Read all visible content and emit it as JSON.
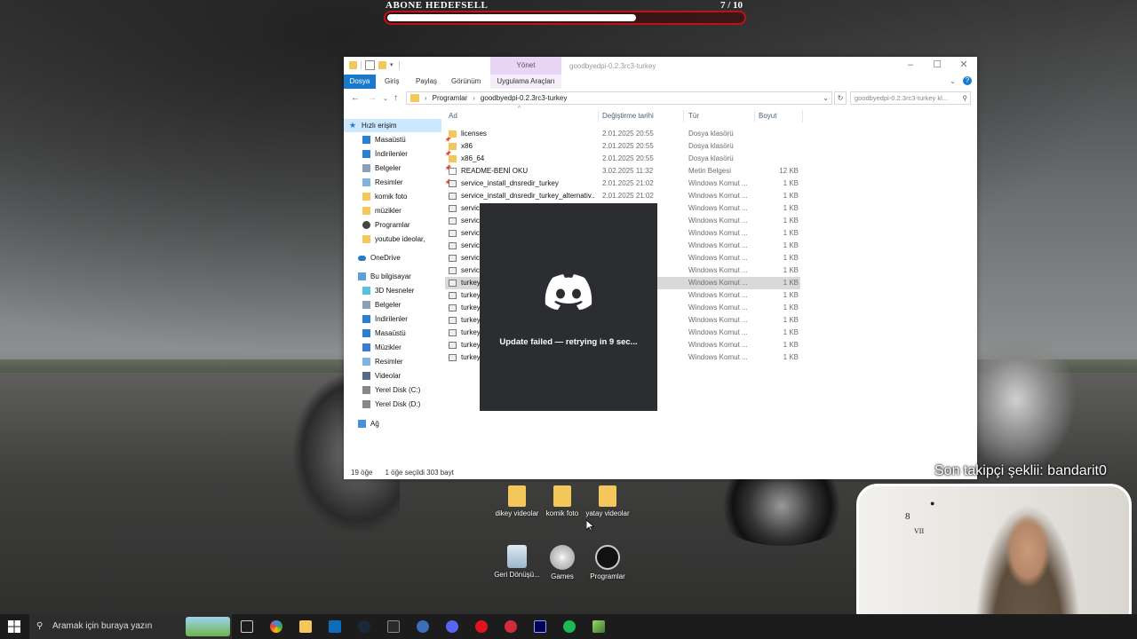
{
  "goal": {
    "title": "ABONE HEDEFSELL",
    "count": "7 / 10",
    "progress": 0.7
  },
  "explorer": {
    "window_title": "goodbyedpi-0.2.3rc3-turkey",
    "context_tab": "Yönet",
    "ribbon_tabs": {
      "file": "Dosya",
      "home": "Giriş",
      "share": "Paylaş",
      "view": "Görünüm",
      "app_tools": "Uygulama Araçları"
    },
    "breadcrumb": [
      "Programlar",
      "goodbyedpi-0.2.3rc3-turkey"
    ],
    "search_placeholder": "goodbyedpi-0.2.3rc3-turkey kl...",
    "columns": {
      "name": "Ad",
      "date": "Değiştirme tarihi",
      "type": "Tür",
      "size": "Boyut"
    },
    "nav": {
      "quick_access": "Hızlı erişim",
      "quick_items": [
        "Masaüstü",
        "İndirilenler",
        "Belgeler",
        "Resimler",
        "komik foto",
        "müzikler",
        "Programlar",
        "youtube ideolar,"
      ],
      "onedrive": "OneDrive",
      "this_pc": "Bu bilgisayar",
      "pc_items": [
        "3D Nesneler",
        "Belgeler",
        "İndirilenler",
        "Masaüstü",
        "Müzikler",
        "Resimler",
        "Videolar",
        "Yerel Disk (C:)",
        "Yerel Disk (D:)"
      ],
      "network": "Ağ"
    },
    "files": [
      {
        "name": "licenses",
        "date": "2.01.2025 20:55",
        "type": "Dosya klasörü",
        "size": "",
        "icon": "folder"
      },
      {
        "name": "x86",
        "date": "2.01.2025 20:55",
        "type": "Dosya klasörü",
        "size": "",
        "icon": "folder"
      },
      {
        "name": "x86_64",
        "date": "2.01.2025 20:55",
        "type": "Dosya klasörü",
        "size": "",
        "icon": "folder"
      },
      {
        "name": "README-BENİ OKU",
        "date": "3.02.2025 11:32",
        "type": "Metin Belgesi",
        "size": "12 KB",
        "icon": "txt"
      },
      {
        "name": "service_install_dnsredir_turkey",
        "date": "2.01.2025 21:02",
        "type": "Windows Komut ...",
        "size": "1 KB",
        "icon": "cmd"
      },
      {
        "name": "service_install_dnsredir_turkey_alternativ...",
        "date": "2.01.2025 21:02",
        "type": "Windows Komut ...",
        "size": "1 KB",
        "icon": "cmd"
      },
      {
        "name": "service",
        "date": "",
        "type": "Windows Komut ...",
        "size": "1 KB",
        "icon": "cmd"
      },
      {
        "name": "service",
        "date": "",
        "type": "Windows Komut ...",
        "size": "1 KB",
        "icon": "cmd"
      },
      {
        "name": "service",
        "date": "",
        "type": "Windows Komut ...",
        "size": "1 KB",
        "icon": "cmd"
      },
      {
        "name": "service",
        "date": "",
        "type": "Windows Komut ...",
        "size": "1 KB",
        "icon": "cmd"
      },
      {
        "name": "service",
        "date": "",
        "type": "Windows Komut ...",
        "size": "1 KB",
        "icon": "cmd"
      },
      {
        "name": "service",
        "date": "",
        "type": "Windows Komut ...",
        "size": "1 KB",
        "icon": "cmd"
      },
      {
        "name": "turkey",
        "date": "",
        "type": "Windows Komut ...",
        "size": "1 KB",
        "icon": "cmd",
        "selected": true
      },
      {
        "name": "turkey",
        "date": "",
        "type": "Windows Komut ...",
        "size": "1 KB",
        "icon": "cmd"
      },
      {
        "name": "turkey",
        "date": "",
        "type": "Windows Komut ...",
        "size": "1 KB",
        "icon": "cmd"
      },
      {
        "name": "turkey",
        "date": "",
        "type": "Windows Komut ...",
        "size": "1 KB",
        "icon": "cmd"
      },
      {
        "name": "turkey",
        "date": "",
        "type": "Windows Komut ...",
        "size": "1 KB",
        "icon": "cmd"
      },
      {
        "name": "turkey",
        "date": "",
        "type": "Windows Komut ...",
        "size": "1 KB",
        "icon": "cmd"
      },
      {
        "name": "turkey",
        "date": "",
        "type": "Windows Komut ...",
        "size": "1 KB",
        "icon": "cmd"
      }
    ],
    "status": {
      "count": "19 öğe",
      "selected": "1 öğe seçildi  303 bayt"
    }
  },
  "discord": {
    "message": "Update failed — retrying in 9 sec..."
  },
  "desktop_icons": {
    "dikey": "dikey videolar",
    "komik": "komik foto",
    "yatay": "yatay videolar",
    "recycle": "Geri Dönüşü...",
    "games": "Games",
    "programlar": "Programlar"
  },
  "overlay": {
    "follower": "Son takipçi şeklii: bandarit0"
  },
  "taskbar": {
    "search_placeholder": "Aramak için buraya yazın"
  },
  "colors": {
    "accent": "#1979ca",
    "goal_border": "#c0101a",
    "discord_bg": "#2b2d31"
  }
}
